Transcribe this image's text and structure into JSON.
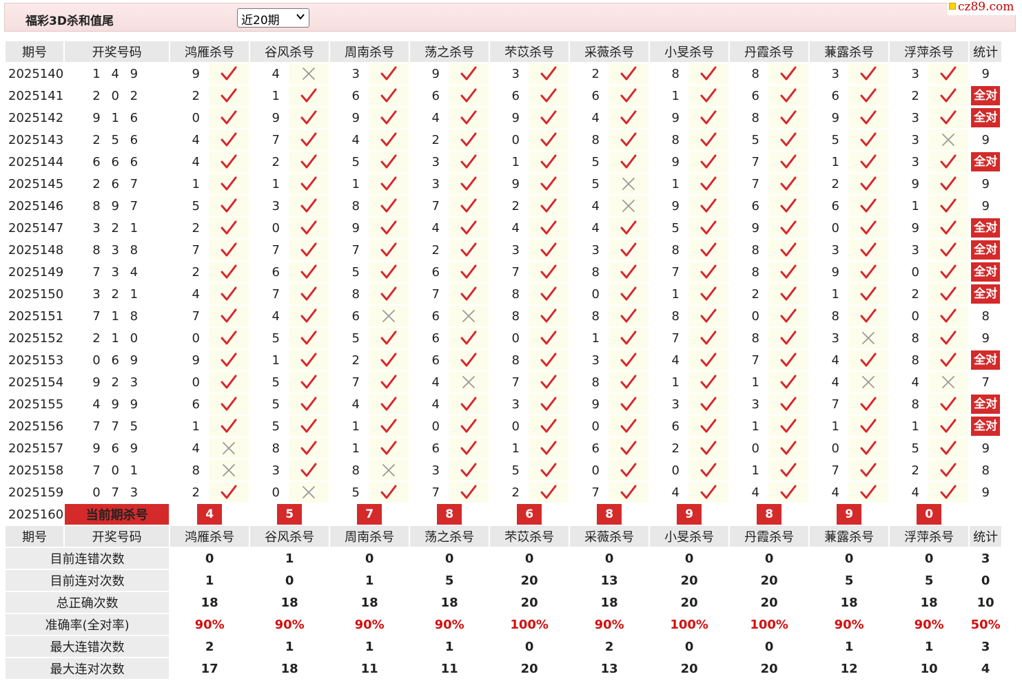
{
  "header": {
    "title": "福彩3D杀和值尾",
    "period_select": "近20期",
    "logo_text": "cz89.com"
  },
  "columns": {
    "period": "期号",
    "winning": "开奖号码",
    "experts": [
      "鸿雁杀号",
      "谷风杀号",
      "周南杀号",
      "荡之杀号",
      "芣苡杀号",
      "采薇杀号",
      "小旻杀号",
      "丹霞杀号",
      "蒹露杀号",
      "浮萍杀号"
    ],
    "stats": "统计"
  },
  "all_correct_label": "全对",
  "rows": [
    {
      "period": "2025140",
      "winning": "1 4 9",
      "kills": [
        [
          9,
          1
        ],
        [
          4,
          0
        ],
        [
          3,
          1
        ],
        [
          9,
          1
        ],
        [
          3,
          1
        ],
        [
          2,
          1
        ],
        [
          8,
          1
        ],
        [
          8,
          1
        ],
        [
          3,
          1
        ],
        [
          3,
          1
        ]
      ],
      "stat": "9"
    },
    {
      "period": "2025141",
      "winning": "2 0 2",
      "kills": [
        [
          2,
          1
        ],
        [
          1,
          1
        ],
        [
          6,
          1
        ],
        [
          6,
          1
        ],
        [
          6,
          1
        ],
        [
          6,
          1
        ],
        [
          1,
          1
        ],
        [
          6,
          1
        ],
        [
          6,
          1
        ],
        [
          2,
          1
        ]
      ],
      "stat": "全对"
    },
    {
      "period": "2025142",
      "winning": "9 1 6",
      "kills": [
        [
          0,
          1
        ],
        [
          9,
          1
        ],
        [
          9,
          1
        ],
        [
          4,
          1
        ],
        [
          9,
          1
        ],
        [
          4,
          1
        ],
        [
          9,
          1
        ],
        [
          8,
          1
        ],
        [
          9,
          1
        ],
        [
          3,
          1
        ]
      ],
      "stat": "全对"
    },
    {
      "period": "2025143",
      "winning": "2 5 6",
      "kills": [
        [
          4,
          1
        ],
        [
          7,
          1
        ],
        [
          4,
          1
        ],
        [
          2,
          1
        ],
        [
          0,
          1
        ],
        [
          8,
          1
        ],
        [
          8,
          1
        ],
        [
          5,
          1
        ],
        [
          5,
          1
        ],
        [
          3,
          0
        ]
      ],
      "stat": "9"
    },
    {
      "period": "2025144",
      "winning": "6 6 6",
      "kills": [
        [
          4,
          1
        ],
        [
          2,
          1
        ],
        [
          5,
          1
        ],
        [
          3,
          1
        ],
        [
          1,
          1
        ],
        [
          5,
          1
        ],
        [
          9,
          1
        ],
        [
          7,
          1
        ],
        [
          1,
          1
        ],
        [
          3,
          1
        ]
      ],
      "stat": "全对"
    },
    {
      "period": "2025145",
      "winning": "2 6 7",
      "kills": [
        [
          1,
          1
        ],
        [
          1,
          1
        ],
        [
          1,
          1
        ],
        [
          3,
          1
        ],
        [
          9,
          1
        ],
        [
          5,
          0
        ],
        [
          1,
          1
        ],
        [
          7,
          1
        ],
        [
          2,
          1
        ],
        [
          9,
          1
        ]
      ],
      "stat": "9"
    },
    {
      "period": "2025146",
      "winning": "8 9 7",
      "kills": [
        [
          5,
          1
        ],
        [
          3,
          1
        ],
        [
          8,
          1
        ],
        [
          7,
          1
        ],
        [
          2,
          1
        ],
        [
          4,
          0
        ],
        [
          9,
          1
        ],
        [
          6,
          1
        ],
        [
          6,
          1
        ],
        [
          1,
          1
        ]
      ],
      "stat": "9"
    },
    {
      "period": "2025147",
      "winning": "3 2 1",
      "kills": [
        [
          2,
          1
        ],
        [
          0,
          1
        ],
        [
          9,
          1
        ],
        [
          4,
          1
        ],
        [
          4,
          1
        ],
        [
          4,
          1
        ],
        [
          5,
          1
        ],
        [
          9,
          1
        ],
        [
          0,
          1
        ],
        [
          9,
          1
        ]
      ],
      "stat": "全对"
    },
    {
      "period": "2025148",
      "winning": "8 3 8",
      "kills": [
        [
          7,
          1
        ],
        [
          7,
          1
        ],
        [
          7,
          1
        ],
        [
          2,
          1
        ],
        [
          3,
          1
        ],
        [
          3,
          1
        ],
        [
          8,
          1
        ],
        [
          8,
          1
        ],
        [
          3,
          1
        ],
        [
          3,
          1
        ]
      ],
      "stat": "全对"
    },
    {
      "period": "2025149",
      "winning": "7 3 4",
      "kills": [
        [
          2,
          1
        ],
        [
          6,
          1
        ],
        [
          5,
          1
        ],
        [
          6,
          1
        ],
        [
          7,
          1
        ],
        [
          8,
          1
        ],
        [
          7,
          1
        ],
        [
          8,
          1
        ],
        [
          9,
          1
        ],
        [
          0,
          1
        ]
      ],
      "stat": "全对"
    },
    {
      "period": "2025150",
      "winning": "3 2 1",
      "kills": [
        [
          4,
          1
        ],
        [
          7,
          1
        ],
        [
          8,
          1
        ],
        [
          7,
          1
        ],
        [
          8,
          1
        ],
        [
          0,
          1
        ],
        [
          1,
          1
        ],
        [
          2,
          1
        ],
        [
          1,
          1
        ],
        [
          2,
          1
        ]
      ],
      "stat": "全对"
    },
    {
      "period": "2025151",
      "winning": "7 1 8",
      "kills": [
        [
          7,
          1
        ],
        [
          4,
          1
        ],
        [
          6,
          0
        ],
        [
          6,
          0
        ],
        [
          8,
          1
        ],
        [
          8,
          1
        ],
        [
          8,
          1
        ],
        [
          0,
          1
        ],
        [
          8,
          1
        ],
        [
          0,
          1
        ]
      ],
      "stat": "8"
    },
    {
      "period": "2025152",
      "winning": "2 1 0",
      "kills": [
        [
          0,
          1
        ],
        [
          5,
          1
        ],
        [
          5,
          1
        ],
        [
          6,
          1
        ],
        [
          0,
          1
        ],
        [
          1,
          1
        ],
        [
          7,
          1
        ],
        [
          8,
          1
        ],
        [
          3,
          0
        ],
        [
          8,
          1
        ]
      ],
      "stat": "9"
    },
    {
      "period": "2025153",
      "winning": "0 6 9",
      "kills": [
        [
          9,
          1
        ],
        [
          1,
          1
        ],
        [
          2,
          1
        ],
        [
          6,
          1
        ],
        [
          8,
          1
        ],
        [
          3,
          1
        ],
        [
          4,
          1
        ],
        [
          7,
          1
        ],
        [
          4,
          1
        ],
        [
          8,
          1
        ]
      ],
      "stat": "全对"
    },
    {
      "period": "2025154",
      "winning": "9 2 3",
      "kills": [
        [
          0,
          1
        ],
        [
          5,
          1
        ],
        [
          7,
          1
        ],
        [
          4,
          0
        ],
        [
          7,
          1
        ],
        [
          8,
          1
        ],
        [
          1,
          1
        ],
        [
          1,
          1
        ],
        [
          4,
          0
        ],
        [
          4,
          0
        ]
      ],
      "stat": "7"
    },
    {
      "period": "2025155",
      "winning": "4 9 9",
      "kills": [
        [
          6,
          1
        ],
        [
          5,
          1
        ],
        [
          4,
          1
        ],
        [
          4,
          1
        ],
        [
          3,
          1
        ],
        [
          9,
          1
        ],
        [
          3,
          1
        ],
        [
          3,
          1
        ],
        [
          7,
          1
        ],
        [
          8,
          1
        ]
      ],
      "stat": "全对"
    },
    {
      "period": "2025156",
      "winning": "7 7 5",
      "kills": [
        [
          1,
          1
        ],
        [
          5,
          1
        ],
        [
          1,
          1
        ],
        [
          0,
          1
        ],
        [
          0,
          1
        ],
        [
          0,
          1
        ],
        [
          6,
          1
        ],
        [
          1,
          1
        ],
        [
          1,
          1
        ],
        [
          1,
          1
        ]
      ],
      "stat": "全对"
    },
    {
      "period": "2025157",
      "winning": "9 6 9",
      "kills": [
        [
          4,
          0
        ],
        [
          8,
          1
        ],
        [
          1,
          1
        ],
        [
          6,
          1
        ],
        [
          1,
          1
        ],
        [
          6,
          1
        ],
        [
          2,
          1
        ],
        [
          0,
          1
        ],
        [
          0,
          1
        ],
        [
          5,
          1
        ]
      ],
      "stat": "9"
    },
    {
      "period": "2025158",
      "winning": "7 0 1",
      "kills": [
        [
          8,
          0
        ],
        [
          3,
          1
        ],
        [
          8,
          0
        ],
        [
          3,
          1
        ],
        [
          5,
          1
        ],
        [
          0,
          1
        ],
        [
          0,
          1
        ],
        [
          1,
          1
        ],
        [
          7,
          1
        ],
        [
          2,
          1
        ]
      ],
      "stat": "8"
    },
    {
      "period": "2025159",
      "winning": "0 7 3",
      "kills": [
        [
          2,
          1
        ],
        [
          0,
          0
        ],
        [
          5,
          1
        ],
        [
          7,
          1
        ],
        [
          2,
          1
        ],
        [
          7,
          1
        ],
        [
          4,
          1
        ],
        [
          4,
          1
        ],
        [
          4,
          1
        ],
        [
          4,
          1
        ]
      ],
      "stat": "9"
    }
  ],
  "current": {
    "period": "2025160",
    "label": "当前期杀号",
    "kills": [
      "4",
      "5",
      "7",
      "8",
      "6",
      "8",
      "9",
      "8",
      "9",
      "0"
    ]
  },
  "stats": [
    {
      "label": "目前连错次数",
      "values": [
        "0",
        "1",
        "0",
        "0",
        "0",
        "0",
        "0",
        "0",
        "0",
        "0"
      ],
      "total": "3",
      "rate": false
    },
    {
      "label": "目前连对次数",
      "values": [
        "1",
        "0",
        "1",
        "5",
        "20",
        "13",
        "20",
        "20",
        "5",
        "5"
      ],
      "total": "0",
      "rate": false
    },
    {
      "label": "总正确次数",
      "values": [
        "18",
        "18",
        "18",
        "18",
        "20",
        "18",
        "20",
        "20",
        "18",
        "18"
      ],
      "total": "10",
      "rate": false
    },
    {
      "label": "准确率(全对率)",
      "values": [
        "90%",
        "90%",
        "90%",
        "90%",
        "100%",
        "90%",
        "100%",
        "100%",
        "90%",
        "90%"
      ],
      "total": "50%",
      "rate": true
    },
    {
      "label": "最大连错次数",
      "values": [
        "2",
        "1",
        "1",
        "1",
        "0",
        "2",
        "0",
        "0",
        "1",
        "1"
      ],
      "total": "3",
      "rate": false
    },
    {
      "label": "最大连对次数",
      "values": [
        "17",
        "18",
        "11",
        "11",
        "20",
        "13",
        "20",
        "20",
        "12",
        "10"
      ],
      "total": "4",
      "rate": false
    }
  ],
  "colors": {
    "accent_red": "#d42a2a",
    "check_red": "#d9262c",
    "cross_gray": "#9a9a9a",
    "stat_blue": "#1a2fb8"
  },
  "icons": {
    "correct": "check-icon",
    "wrong": "cross-icon",
    "dropdown": "chevron-down-icon"
  }
}
